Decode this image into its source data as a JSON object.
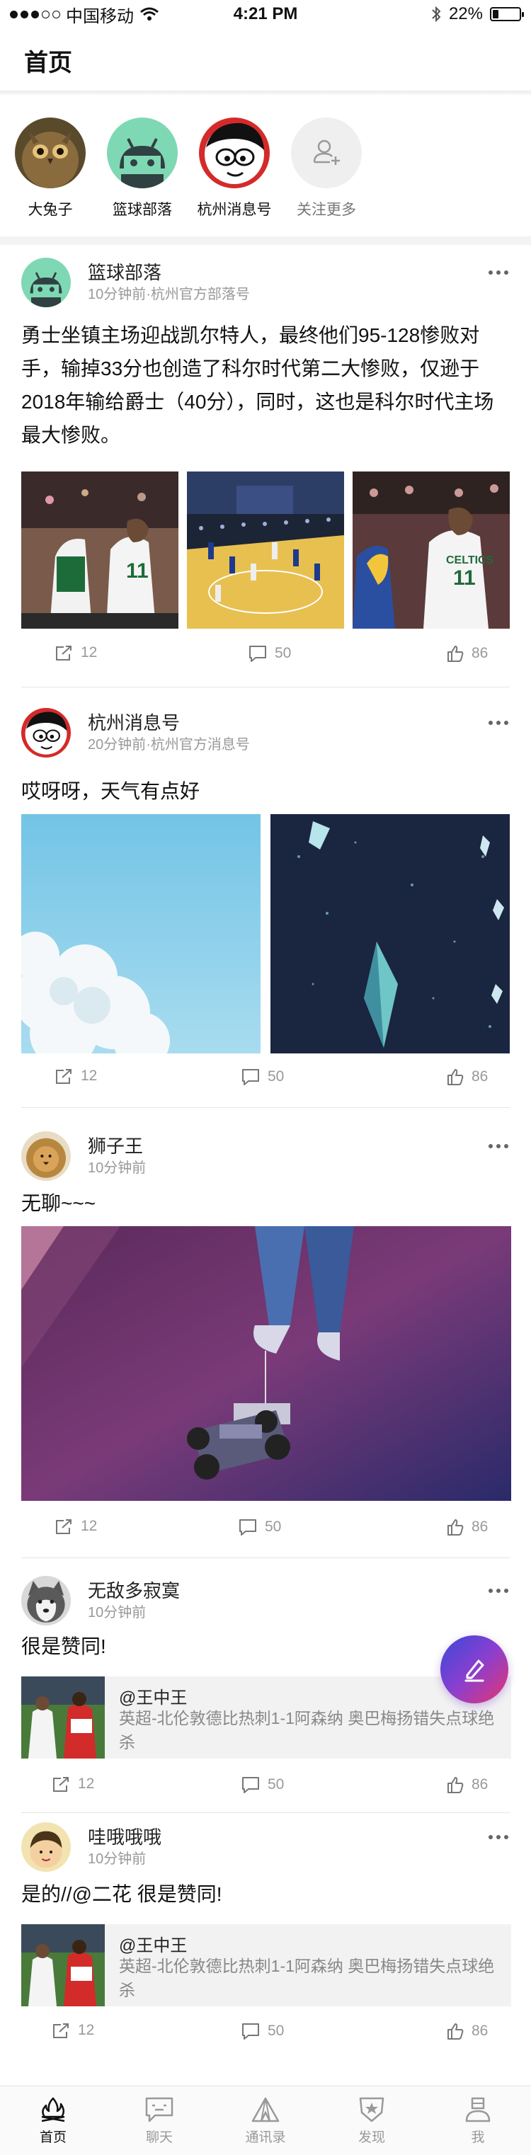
{
  "status_bar": {
    "carrier": "中国移动",
    "time": "4:21 PM",
    "battery": "22%",
    "battery_level": 0.22
  },
  "header": {
    "title": "首页"
  },
  "follow": {
    "items": [
      {
        "label": "大兔子",
        "icon": "owl-avatar"
      },
      {
        "label": "篮球部落",
        "icon": "android-avatar"
      },
      {
        "label": "杭州消息号",
        "icon": "cartoon-face-avatar"
      },
      {
        "label": "关注更多",
        "icon": "add-user-icon"
      }
    ]
  },
  "posts": [
    {
      "name": "篮球部落",
      "sub": "10分钟前·杭州官方部落号",
      "text": "勇士坐镇主场迎战凯尔特人，最终他们95-128惨败对手，输掉33分也创造了科尔时代第二大惨败，仅逊于2018年输给爵士（40分），同时，这也是科尔时代主场最大惨败。",
      "shares": "12",
      "comments": "50",
      "likes": "86"
    },
    {
      "name": "杭州消息号",
      "sub": "20分钟前·杭州官方消息号",
      "text": "哎呀呀，天气有点好",
      "shares": "12",
      "comments": "50",
      "likes": "86"
    },
    {
      "name": "狮子王",
      "sub": "10分钟前",
      "text": "无聊~~~",
      "shares": "12",
      "comments": "50",
      "likes": "86"
    },
    {
      "name": "无敌多寂寞",
      "sub": "10分钟前",
      "text": "很是赞同!",
      "quote": {
        "author": "@王中王",
        "text": "英超-北伦敦德比热刺1-1阿森纳 奥巴梅扬错失点球绝杀"
      },
      "shares": "12",
      "comments": "50",
      "likes": "86"
    },
    {
      "name": "哇哦哦哦",
      "sub": "10分钟前",
      "text": "是的//@二花 很是赞同!",
      "quote": {
        "author": "@王中王",
        "text": "英超-北伦敦德比热刺1-1阿森纳 奥巴梅扬错失点球绝杀"
      },
      "shares": "12",
      "comments": "50",
      "likes": "86"
    }
  ],
  "tabbar": {
    "items": [
      {
        "label": "首页",
        "icon": "campfire-icon",
        "active": true
      },
      {
        "label": "聊天",
        "icon": "chat-icon",
        "active": false
      },
      {
        "label": "通讯录",
        "icon": "tent-icon",
        "active": false
      },
      {
        "label": "发现",
        "icon": "star-badge-icon",
        "active": false
      },
      {
        "label": "我",
        "icon": "person-icon",
        "active": false
      }
    ]
  },
  "colors": {
    "accent_gradient": [
      "#3a49d8",
      "#8a3fcf",
      "#e8356e"
    ],
    "muted_text": "#999999"
  }
}
